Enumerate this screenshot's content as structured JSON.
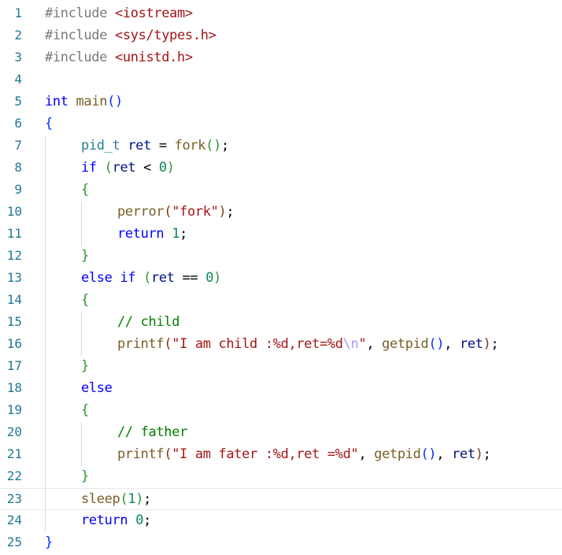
{
  "editor": {
    "current_line": 23,
    "colors": {
      "line_number": "#237893",
      "keyword": "#0000ff",
      "string": "#a31515",
      "number": "#098658",
      "comment": "#008000",
      "escape": "#ae94ff",
      "function": "#795e26",
      "variable": "#001080",
      "type": "#267f99"
    },
    "lines": [
      {
        "n": "1",
        "indent": 0,
        "tokens": [
          {
            "t": "#include ",
            "c": "pre"
          },
          {
            "t": "<iostream>",
            "c": "ang"
          }
        ]
      },
      {
        "n": "2",
        "indent": 0,
        "tokens": [
          {
            "t": "#include ",
            "c": "pre"
          },
          {
            "t": "<sys/types.h>",
            "c": "ang"
          }
        ]
      },
      {
        "n": "3",
        "indent": 0,
        "tokens": [
          {
            "t": "#include ",
            "c": "pre"
          },
          {
            "t": "<unistd.h>",
            "c": "ang"
          }
        ]
      },
      {
        "n": "4",
        "indent": 0,
        "tokens": []
      },
      {
        "n": "5",
        "indent": 0,
        "tokens": [
          {
            "t": "int",
            "c": "kw"
          },
          {
            "t": " ",
            "c": "plain"
          },
          {
            "t": "main",
            "c": "fn"
          },
          {
            "t": "()",
            "c": "b1"
          }
        ]
      },
      {
        "n": "6",
        "indent": 0,
        "tokens": [
          {
            "t": "{",
            "c": "b1"
          }
        ]
      },
      {
        "n": "7",
        "indent": 1,
        "tokens": [
          {
            "t": "pid_t",
            "c": "typ"
          },
          {
            "t": " ",
            "c": "plain"
          },
          {
            "t": "ret",
            "c": "var"
          },
          {
            "t": " = ",
            "c": "plain"
          },
          {
            "t": "fork",
            "c": "fn"
          },
          {
            "t": "()",
            "c": "b2"
          },
          {
            "t": ";",
            "c": "plain"
          }
        ]
      },
      {
        "n": "8",
        "indent": 1,
        "tokens": [
          {
            "t": "if",
            "c": "kw"
          },
          {
            "t": " ",
            "c": "plain"
          },
          {
            "t": "(",
            "c": "b2"
          },
          {
            "t": "ret",
            "c": "var"
          },
          {
            "t": " < ",
            "c": "plain"
          },
          {
            "t": "0",
            "c": "num"
          },
          {
            "t": ")",
            "c": "b2"
          }
        ]
      },
      {
        "n": "9",
        "indent": 1,
        "tokens": [
          {
            "t": "{",
            "c": "b2"
          }
        ]
      },
      {
        "n": "10",
        "indent": 2,
        "tokens": [
          {
            "t": "perror",
            "c": "fn"
          },
          {
            "t": "(",
            "c": "b3"
          },
          {
            "t": "\"fork\"",
            "c": "str"
          },
          {
            "t": ")",
            "c": "b3"
          },
          {
            "t": ";",
            "c": "plain"
          }
        ]
      },
      {
        "n": "11",
        "indent": 2,
        "tokens": [
          {
            "t": "return",
            "c": "kw"
          },
          {
            "t": " ",
            "c": "plain"
          },
          {
            "t": "1",
            "c": "num"
          },
          {
            "t": ";",
            "c": "plain"
          }
        ]
      },
      {
        "n": "12",
        "indent": 1,
        "tokens": [
          {
            "t": "}",
            "c": "b2"
          }
        ]
      },
      {
        "n": "13",
        "indent": 1,
        "tokens": [
          {
            "t": "else",
            "c": "kw"
          },
          {
            "t": " ",
            "c": "plain"
          },
          {
            "t": "if",
            "c": "kw"
          },
          {
            "t": " ",
            "c": "plain"
          },
          {
            "t": "(",
            "c": "b2"
          },
          {
            "t": "ret",
            "c": "var"
          },
          {
            "t": " == ",
            "c": "plain"
          },
          {
            "t": "0",
            "c": "num"
          },
          {
            "t": ")",
            "c": "b2"
          }
        ]
      },
      {
        "n": "14",
        "indent": 1,
        "tokens": [
          {
            "t": "{",
            "c": "b2"
          }
        ]
      },
      {
        "n": "15",
        "indent": 2,
        "tokens": [
          {
            "t": "// child",
            "c": "cmt"
          }
        ]
      },
      {
        "n": "16",
        "indent": 2,
        "tokens": [
          {
            "t": "printf",
            "c": "fn"
          },
          {
            "t": "(",
            "c": "b3"
          },
          {
            "t": "\"I am child :%d,ret=%d",
            "c": "str"
          },
          {
            "t": "\\n",
            "c": "esc"
          },
          {
            "t": "\"",
            "c": "str"
          },
          {
            "t": ", ",
            "c": "plain"
          },
          {
            "t": "getpid",
            "c": "fn"
          },
          {
            "t": "()",
            "c": "b1"
          },
          {
            "t": ", ",
            "c": "plain"
          },
          {
            "t": "ret",
            "c": "var"
          },
          {
            "t": ")",
            "c": "b3"
          },
          {
            "t": ";",
            "c": "plain"
          }
        ]
      },
      {
        "n": "17",
        "indent": 1,
        "tokens": [
          {
            "t": "}",
            "c": "b2"
          }
        ]
      },
      {
        "n": "18",
        "indent": 1,
        "tokens": [
          {
            "t": "else",
            "c": "kw"
          }
        ]
      },
      {
        "n": "19",
        "indent": 1,
        "tokens": [
          {
            "t": "{",
            "c": "b2"
          }
        ]
      },
      {
        "n": "20",
        "indent": 2,
        "tokens": [
          {
            "t": "// father",
            "c": "cmt"
          }
        ]
      },
      {
        "n": "21",
        "indent": 2,
        "tokens": [
          {
            "t": "printf",
            "c": "fn"
          },
          {
            "t": "(",
            "c": "b3"
          },
          {
            "t": "\"I am fater :%d,ret =%d\"",
            "c": "str"
          },
          {
            "t": ", ",
            "c": "plain"
          },
          {
            "t": "getpid",
            "c": "fn"
          },
          {
            "t": "()",
            "c": "b1"
          },
          {
            "t": ", ",
            "c": "plain"
          },
          {
            "t": "ret",
            "c": "var"
          },
          {
            "t": ")",
            "c": "b3"
          },
          {
            "t": ";",
            "c": "plain"
          }
        ]
      },
      {
        "n": "22",
        "indent": 1,
        "tokens": [
          {
            "t": "}",
            "c": "b2"
          }
        ]
      },
      {
        "n": "23",
        "indent": 1,
        "tokens": [
          {
            "t": "sleep",
            "c": "fn"
          },
          {
            "t": "(",
            "c": "b2"
          },
          {
            "t": "1",
            "c": "num"
          },
          {
            "t": ")",
            "c": "b2"
          },
          {
            "t": ";",
            "c": "plain"
          }
        ]
      },
      {
        "n": "24",
        "indent": 1,
        "tokens": [
          {
            "t": "return",
            "c": "kw"
          },
          {
            "t": " ",
            "c": "plain"
          },
          {
            "t": "0",
            "c": "num"
          },
          {
            "t": ";",
            "c": "plain"
          }
        ]
      },
      {
        "n": "25",
        "indent": 0,
        "tokens": [
          {
            "t": "}",
            "c": "b1"
          }
        ]
      }
    ]
  }
}
